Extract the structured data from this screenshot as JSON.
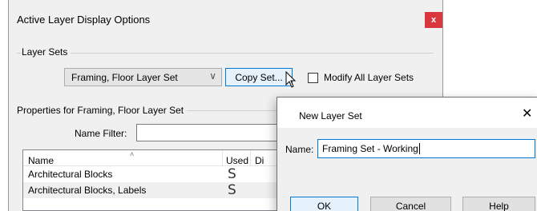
{
  "main_dialog": {
    "title": "Active Layer Display Options",
    "close_label": "x",
    "layer_sets_group": "Layer Sets",
    "layer_set_select": {
      "value": "Framing, Floor Layer Set",
      "arrow": "∨"
    },
    "copy_set_button": "Copy Set...",
    "modify_all_checkbox": {
      "label": "Modify All Layer Sets",
      "checked": false
    },
    "properties_group": "Properties for Framing, Floor Layer Set",
    "name_filter_label": "Name Filter:",
    "name_filter_value": "",
    "table": {
      "columns": [
        "Name",
        "Used",
        "Di"
      ],
      "rows": [
        {
          "name": "Architectural Blocks",
          "used": "S"
        },
        {
          "name": "Architectural Blocks, Labels",
          "used": "S"
        }
      ]
    }
  },
  "new_layer_dialog": {
    "title": "New Layer Set",
    "close_label": "✕",
    "name_label": "Name:",
    "name_value": "Framing Set - Working",
    "ok_button": "OK",
    "cancel_button": "Cancel",
    "help_button": "Help"
  },
  "colors": {
    "close_red": "#d9363e",
    "focus_blue": "#0078d7",
    "dialog_bg": "#f0f0f0"
  },
  "icons": {
    "cursor": "arrow-pointer-icon",
    "sort": "sort-up-icon"
  }
}
